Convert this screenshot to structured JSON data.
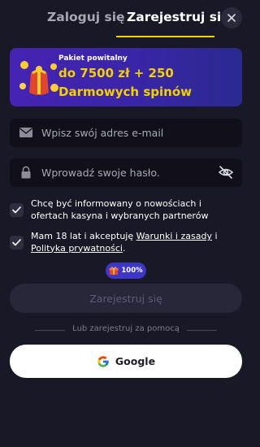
{
  "tabs": {
    "login": "Zaloguj się",
    "register": "Zarejestruj się",
    "active": "register"
  },
  "banner": {
    "subtitle": "Pakiet powitalny",
    "line1": "do 7500 zł + 250",
    "line2": "Darmowych spinów"
  },
  "email": {
    "placeholder": "Wpisz swój adres e-mail",
    "value": ""
  },
  "password": {
    "placeholder": "Wprowadź swoje hasło.",
    "value": ""
  },
  "consent_marketing": {
    "checked": true,
    "text": "Chcę być informowany o nowościach i ofertach kasyna i wybranych partnerów"
  },
  "consent_terms": {
    "checked": true,
    "prefix": "Mam 18 lat i akceptuję ",
    "terms_link": "Warunki i zasady",
    "middle": " i ",
    "privacy_link": "Polityka prywatności",
    "suffix": "."
  },
  "progress_badge": {
    "percent_text": "100%",
    "progress": 1.0
  },
  "submit_label": "Zarejestruj się",
  "divider_text": "Lub zarejestruj za pomocą",
  "google_label": "Google",
  "colors": {
    "background": "#191826",
    "accent": "#f5d000",
    "banner": "#4524b3",
    "field": "#11101a",
    "badge": "#3d36c6"
  }
}
